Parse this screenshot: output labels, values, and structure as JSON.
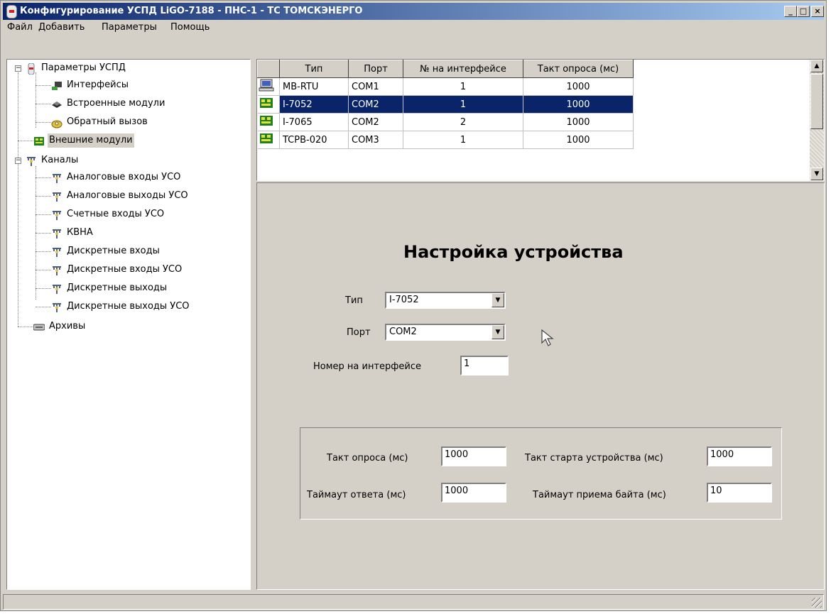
{
  "window": {
    "title": "Конфигурирование УСПД LiGO-7188 - ПНС-1 - ТС ТОМСКЭНЕРГО",
    "minimize": "_",
    "maximize": "□",
    "close": "×"
  },
  "menu": [
    "Файл",
    "Добавить",
    "Параметры",
    "Помощь"
  ],
  "tree": {
    "root1": "Параметры УСПД",
    "interfaces": "Интерфейсы",
    "builtin": "Встроенные модули",
    "callback": "Обратный вызов",
    "external": "Внешние модули",
    "channels": "Каналы",
    "ch_items": [
      "Аналоговые входы УСО",
      "Аналоговые выходы УСО",
      "Счетные входы УСО",
      "КВНА",
      "Дискретные входы",
      "Дискретные входы УСО",
      "Дискретные выходы",
      "Дискретные выходы УСО"
    ],
    "archives": "Архивы",
    "expand_minus": "−"
  },
  "grid": {
    "columns": [
      "Тип",
      "Порт",
      "№ на интерфейсе",
      "Такт опроса (мс)"
    ],
    "rows": [
      [
        "MB-RTU",
        "COM1",
        "1",
        "1000"
      ],
      [
        "I-7052",
        "COM2",
        "1",
        "1000"
      ],
      [
        "I-7065",
        "COM2",
        "2",
        "1000"
      ],
      [
        "TCPB-020",
        "COM3",
        "1",
        "1000"
      ]
    ],
    "selected_row": 1
  },
  "panel": {
    "heading": "Настройка устройства",
    "type_label": "Тип",
    "type_value": "I-7052",
    "port_label": "Порт",
    "port_value": "COM2",
    "num_label": "Номер на интерфейсе",
    "num_value": "1",
    "poll_label": "Такт опроса (мс)",
    "poll_value": "1000",
    "resp_label": "Таймаут ответа (мс)",
    "resp_value": "1000",
    "start_label": "Такт старта устройства (мс)",
    "start_value": "1000",
    "byte_label": "Таймаут приема байта (мс)",
    "byte_value": "10"
  },
  "colors": {
    "selection": "#0a246a",
    "face": "#d4d0c8"
  },
  "glyphs": {
    "arrow_up": "▲",
    "arrow_down": "▼"
  }
}
